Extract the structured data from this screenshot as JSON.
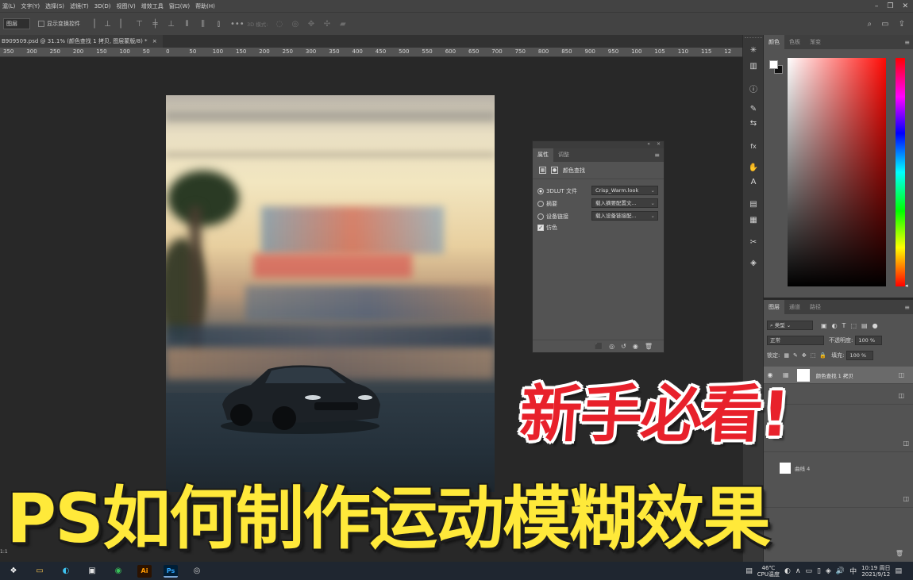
{
  "menubar": {
    "items": [
      "滬(L)",
      "文字(Y)",
      "选择(S)",
      "滤镜(T)",
      "3D(D)",
      "视图(V)",
      "增效工具",
      "窗口(W)",
      "帮助(H)"
    ],
    "window_controls": [
      "–",
      "❐",
      "✕"
    ]
  },
  "options": {
    "tool_select": "图层",
    "show_transform_label": "显示变换控件",
    "mode_3d_label": "3D 模式:",
    "more_label": "•••"
  },
  "document": {
    "tab_title": "B909509.psd @ 31.1% (颜色查找 1 拷贝, 图层蒙版/8) *",
    "close_glyph": "×"
  },
  "ruler": {
    "ticks": [
      "350",
      "300",
      "250",
      "200",
      "150",
      "100",
      "50",
      "0",
      "50",
      "100",
      "150",
      "200",
      "250",
      "300",
      "350",
      "400",
      "450",
      "500",
      "550",
      "600",
      "650",
      "700",
      "750",
      "800",
      "850",
      "900",
      "950",
      "100",
      "105",
      "110",
      "115",
      "12"
    ]
  },
  "properties_panel": {
    "collapse_glyphs": [
      "«",
      "×"
    ],
    "tabs": [
      "属性",
      "调整"
    ],
    "menu_glyph": "≡",
    "header_label": "颜色查找",
    "rows": [
      {
        "type": "radio",
        "selected": true,
        "label": "3DLUT 文件",
        "value": "Crisp_Warm.look"
      },
      {
        "type": "radio",
        "selected": false,
        "label": "摘要",
        "value": "载入摘要配置文..."
      },
      {
        "type": "radio",
        "selected": false,
        "label": "设备链接",
        "value": "载入设备链接配..."
      },
      {
        "type": "checkbox",
        "selected": true,
        "label": "仿色",
        "value": ""
      }
    ],
    "footer_icons": [
      "clip-icon",
      "view-previous-icon",
      "reset-icon",
      "visibility-icon",
      "delete-icon"
    ],
    "footer_glyphs": [
      "⬛",
      "◎",
      "↺",
      "◉",
      "🗑"
    ]
  },
  "toolstrip": {
    "glyphs": [
      "✳",
      "▥",
      "ⓘ",
      "✎",
      "⇆",
      "fx",
      "✋",
      "A",
      "▤",
      "▦",
      "✂",
      "◈"
    ]
  },
  "color_panel": {
    "tabs": [
      "颜色",
      "色板",
      "渐变"
    ],
    "menu_glyph": "≡",
    "foreground": "#ffffff",
    "background": "#111111",
    "hue_base": "#ff0a05"
  },
  "layers_panel": {
    "tabs": [
      "图层",
      "通道",
      "路径"
    ],
    "menu_glyph": "≡",
    "filter_label": "类型",
    "blend_mode": "正常",
    "opacity_label": "不透明度:",
    "opacity_value": "100 %",
    "lock_label": "锁定:",
    "fill_label": "填充:",
    "fill_value": "100 %",
    "layers": [
      {
        "name": "颜色查找 1 拷贝",
        "visible": true,
        "selected": true
      },
      {
        "name": "",
        "visible": false,
        "selected": false
      },
      {
        "name": "",
        "visible": false,
        "selected": false
      },
      {
        "name": "",
        "visible": false,
        "selected": false
      },
      {
        "name": "",
        "visible": false,
        "selected": false
      }
    ],
    "partial_layer_label": "曲线 4"
  },
  "overlay": {
    "headline_red": "新手必看!",
    "headline_yellow": "PS如何制作运动模糊效果"
  },
  "status": {
    "zoom_fragment": "1:1"
  },
  "taskbar": {
    "apps": [
      "start-icon",
      "file-explorer-icon",
      "edge-icon",
      "store-icon",
      "app-green-icon",
      "illustrator-icon",
      "photoshop-icon",
      "obs-icon"
    ],
    "app_glyphs": [
      "❖",
      "▭",
      "◐",
      "▣",
      "◉",
      "Ai",
      "Ps",
      "◎"
    ],
    "cpu_temp_value": "46℃",
    "cpu_temp_label": "CPU温度",
    "time": "10:19 周日",
    "date": "2021/9/12",
    "tray_glyphs": [
      "▤",
      "◐",
      "∧",
      "▭",
      "▯",
      "◈",
      "🔊",
      "中"
    ],
    "notification_glyph": "▤"
  }
}
